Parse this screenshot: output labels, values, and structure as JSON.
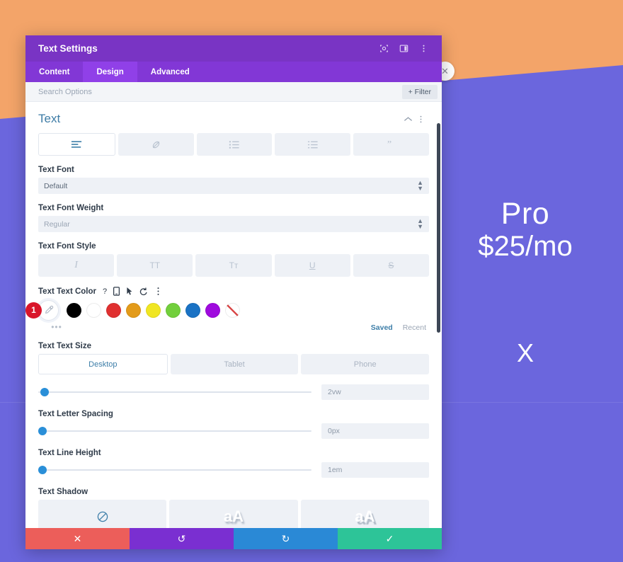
{
  "background": {
    "pro_label": "Pro",
    "price_label": "$25/mo",
    "x_label": "X",
    "orange": "#f3a469",
    "purple": "#6b66dd"
  },
  "close_button": {
    "icon": "close-circle-icon",
    "glyph": "✕"
  },
  "modal": {
    "title": "Text Settings",
    "titlebar_icons": [
      {
        "name": "focus-target-icon"
      },
      {
        "name": "layout-panel-icon"
      },
      {
        "name": "more-vertical-icon"
      }
    ],
    "tabs": [
      {
        "label": "Content",
        "active": false
      },
      {
        "label": "Design",
        "active": true
      },
      {
        "label": "Advanced",
        "active": false
      }
    ],
    "search": {
      "placeholder": "Search Options",
      "value": "",
      "filter_label": "+ Filter"
    },
    "section": {
      "title": "Text",
      "collapse_icon": "chevron-up-icon",
      "menu_icon": "more-vertical-icon"
    },
    "text_format_buttons": [
      {
        "name": "align-left-icon",
        "active": true
      },
      {
        "name": "link-icon",
        "active": false
      },
      {
        "name": "unordered-list-icon",
        "active": false
      },
      {
        "name": "ordered-list-icon",
        "active": false
      },
      {
        "name": "quote-icon",
        "active": false
      }
    ],
    "text_font": {
      "label": "Text Font",
      "value": "Default"
    },
    "text_font_weight": {
      "label": "Text Font Weight",
      "value": "Regular"
    },
    "text_font_style": {
      "label": "Text Font Style",
      "options": [
        {
          "glyph": "I",
          "name": "italic-icon"
        },
        {
          "glyph": "TT",
          "name": "uppercase-icon"
        },
        {
          "glyph": "Tт",
          "name": "small-caps-icon"
        },
        {
          "glyph": "U",
          "name": "underline-icon"
        },
        {
          "glyph": "S",
          "name": "strikethrough-icon"
        }
      ]
    },
    "text_color": {
      "label": "Text Text Color",
      "controls": [
        {
          "glyph": "?",
          "name": "help-icon"
        },
        {
          "glyph": "",
          "name": "responsive-device-icon"
        },
        {
          "glyph": "",
          "name": "hover-cursor-icon"
        },
        {
          "glyph": "↺",
          "name": "reset-icon"
        },
        {
          "glyph": "",
          "name": "more-vertical-icon"
        }
      ],
      "badge": "1",
      "picker_icon": "eyedropper-icon",
      "swatches": [
        "#000000",
        "#ffffff",
        "#e03030",
        "#e39b1a",
        "#f0e622",
        "#72cf3c",
        "#1a72c4",
        "#9f0ade"
      ],
      "transparent_swatch": "transparent-swatch",
      "more_dots": "•••",
      "saved_label": "Saved",
      "recent_label": "Recent"
    },
    "text_size": {
      "label": "Text Text Size",
      "devices": [
        {
          "label": "Desktop",
          "active": true
        },
        {
          "label": "Tablet",
          "active": false
        },
        {
          "label": "Phone",
          "active": false
        }
      ],
      "value": "2vw",
      "slider_percent": 1
    },
    "letter_spacing": {
      "label": "Text Letter Spacing",
      "value": "0px",
      "slider_percent": 0
    },
    "line_height": {
      "label": "Text Line Height",
      "value": "1em",
      "slider_percent": 0
    },
    "text_shadow": {
      "label": "Text Shadow",
      "options": [
        {
          "name": "no-shadow-icon",
          "glyph": "⊘"
        },
        {
          "name": "shadow-preset-1",
          "glyph": "aA"
        },
        {
          "name": "shadow-preset-2",
          "glyph": "aA"
        }
      ]
    },
    "footer": [
      {
        "name": "cancel-button",
        "glyph": "✕",
        "color": "#ec5e5a"
      },
      {
        "name": "undo-button",
        "glyph": "↺",
        "color": "#7a2fd1"
      },
      {
        "name": "redo-button",
        "glyph": "↻",
        "color": "#2a89d6"
      },
      {
        "name": "save-button",
        "glyph": "✓",
        "color": "#2dc498"
      }
    ]
  }
}
